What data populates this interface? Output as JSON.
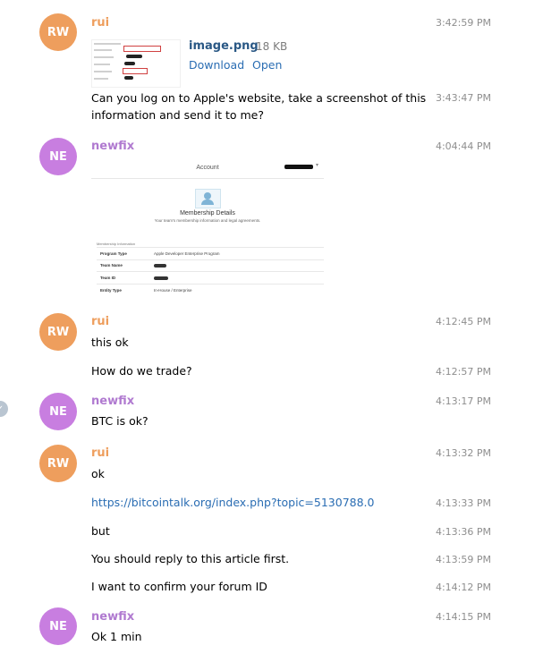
{
  "messages": [
    {
      "sender": "rui",
      "avatar": "RW",
      "time": "3:42:59 PM"
    },
    {
      "text": "Can you log on to Apple's website, take a screenshot of this",
      "text2": "information and send it to me?",
      "time": "3:43:47 PM"
    },
    {
      "sender": "newfix",
      "avatar": "NE",
      "time": "4:04:44 PM"
    },
    {
      "sender": "rui",
      "avatar": "RW",
      "text": "this ok",
      "time": "4:12:45 PM"
    },
    {
      "text": "How do we trade?",
      "time": "4:12:57 PM"
    },
    {
      "sender": "newfix",
      "avatar": "NE",
      "text": "BTC is ok?",
      "time": "4:13:17 PM"
    },
    {
      "sender": "rui",
      "avatar": "RW",
      "text": "ok",
      "time": "4:13:32 PM"
    },
    {
      "text": "https://bitcointalk.org/index.php?topic=5130788.0",
      "time": "4:13:33 PM"
    },
    {
      "text": "but",
      "time": "4:13:36 PM"
    },
    {
      "text": "You should reply to this article first.",
      "time": "4:13:59 PM"
    },
    {
      "text": "I want to confirm your forum ID",
      "time": "4:14:12 PM"
    },
    {
      "sender": "newfix",
      "avatar": "NE",
      "text": "Ok 1 min",
      "time": "4:14:15 PM"
    }
  ],
  "attachment": {
    "name": "image.png",
    "size": "18 KB",
    "download": "Download",
    "open": "Open"
  },
  "screenshot": {
    "header": "Account",
    "heading": "Membership Details",
    "subheading": "Your team's membership information and legal agreements.",
    "section": "Membership Information",
    "rows": [
      {
        "label": "Program Type",
        "value": "Apple Developer Enterprise Program"
      },
      {
        "label": "Team Name",
        "value": ""
      },
      {
        "label": "Team ID",
        "value": ""
      },
      {
        "label": "Entity Type",
        "value": "In-House / Enterprise"
      }
    ]
  },
  "colors": {
    "rui_name": "#ee9e5d",
    "newfix_name": "#b07ad0",
    "avatar_rw": "#ee9e5d",
    "avatar_ne": "#c87ee0",
    "link": "#2a6db3"
  },
  "icons": {
    "edge": "check-icon"
  }
}
